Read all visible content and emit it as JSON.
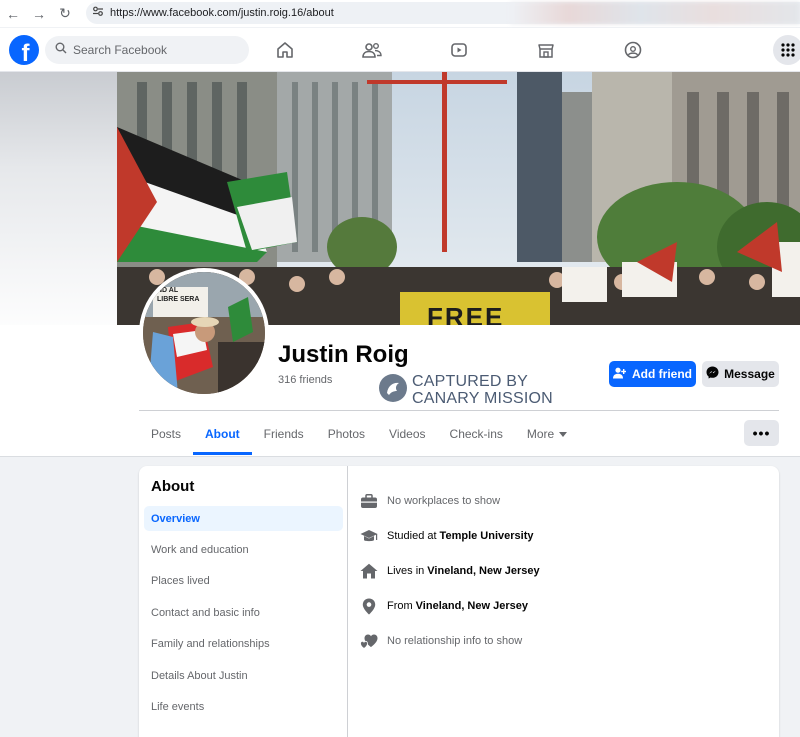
{
  "browser": {
    "url": "https://www.facebook.com/justin.roig.16/about"
  },
  "header": {
    "search_placeholder": "Search Facebook",
    "nav_icons": [
      "home-icon",
      "friends-icon",
      "watch-icon",
      "marketplace-icon",
      "groups-icon"
    ],
    "menu_icon": "grid-menu-icon"
  },
  "profile": {
    "name": "Justin Roig",
    "friends_count": "316 friends",
    "add_friend_label": "Add friend",
    "message_label": "Message",
    "more_label": "•••",
    "cover_banner_text": "FREE",
    "avatar_sign_text": "ND AL\nLIBRE SERA"
  },
  "watermark": {
    "line1": "CAPTURED BY",
    "line2": "CANARY MISSION"
  },
  "tabs": [
    "Posts",
    "About",
    "Friends",
    "Photos",
    "Videos",
    "Check-ins",
    "More"
  ],
  "active_tab": "About",
  "about": {
    "title": "About",
    "sections": [
      "Overview",
      "Work and education",
      "Places lived",
      "Contact and basic info",
      "Family and relationships",
      "Details About Justin",
      "Life events"
    ],
    "active_section": "Overview",
    "overview": {
      "work": "No workplaces to show",
      "education_prefix": "Studied at",
      "education_value": "Temple University",
      "lives_prefix": "Lives in",
      "lives_value": "Vineland, New Jersey",
      "from_prefix": "From",
      "from_value": "Vineland, New Jersey",
      "relationship": "No relationship info to show"
    }
  },
  "colors": {
    "accent": "#0866ff",
    "muted_text": "#65676b",
    "page_background": "#f0f2f5"
  }
}
